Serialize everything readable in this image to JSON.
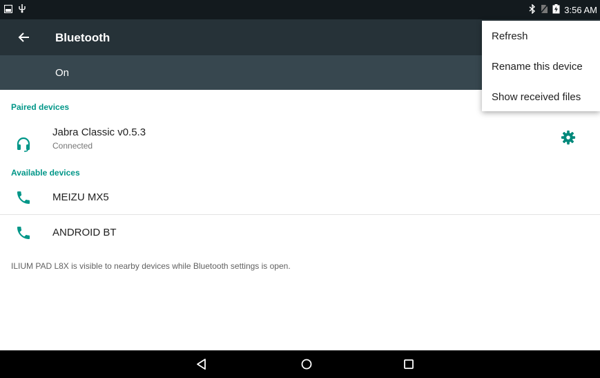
{
  "status_bar": {
    "time": "3:56 AM",
    "left_icons": [
      "gallery-notification-icon",
      "usb-icon"
    ],
    "right_icons": [
      "bluetooth-icon",
      "no-sim-icon",
      "battery-charging-icon"
    ]
  },
  "app_bar": {
    "title": "Bluetooth",
    "back_icon": "arrow-back-icon"
  },
  "switch_bar": {
    "label": "On"
  },
  "paired": {
    "header": "Paired devices",
    "devices": [
      {
        "name": "Jabra Classic v0.5.3",
        "status": "Connected",
        "icon": "headset-icon",
        "settings_icon": "gear-icon"
      }
    ]
  },
  "available": {
    "header": "Available devices",
    "devices": [
      {
        "name": "MEIZU MX5",
        "icon": "phone-icon"
      },
      {
        "name": "ANDROID BT",
        "icon": "phone-icon"
      }
    ]
  },
  "footer_note": "ILIUM PAD L8X is visible to nearby devices while Bluetooth settings is open.",
  "overflow_menu": {
    "items": [
      {
        "label": "Refresh"
      },
      {
        "label": "Rename this device"
      },
      {
        "label": "Show received files"
      }
    ]
  },
  "nav_bar": {
    "icons": [
      "back-triangle-icon",
      "home-circle-icon",
      "recents-square-icon"
    ]
  },
  "colors": {
    "accent": "#009688",
    "app_bar": "#263238",
    "switch_bar": "#37474f",
    "status_bar": "#131a1e"
  }
}
